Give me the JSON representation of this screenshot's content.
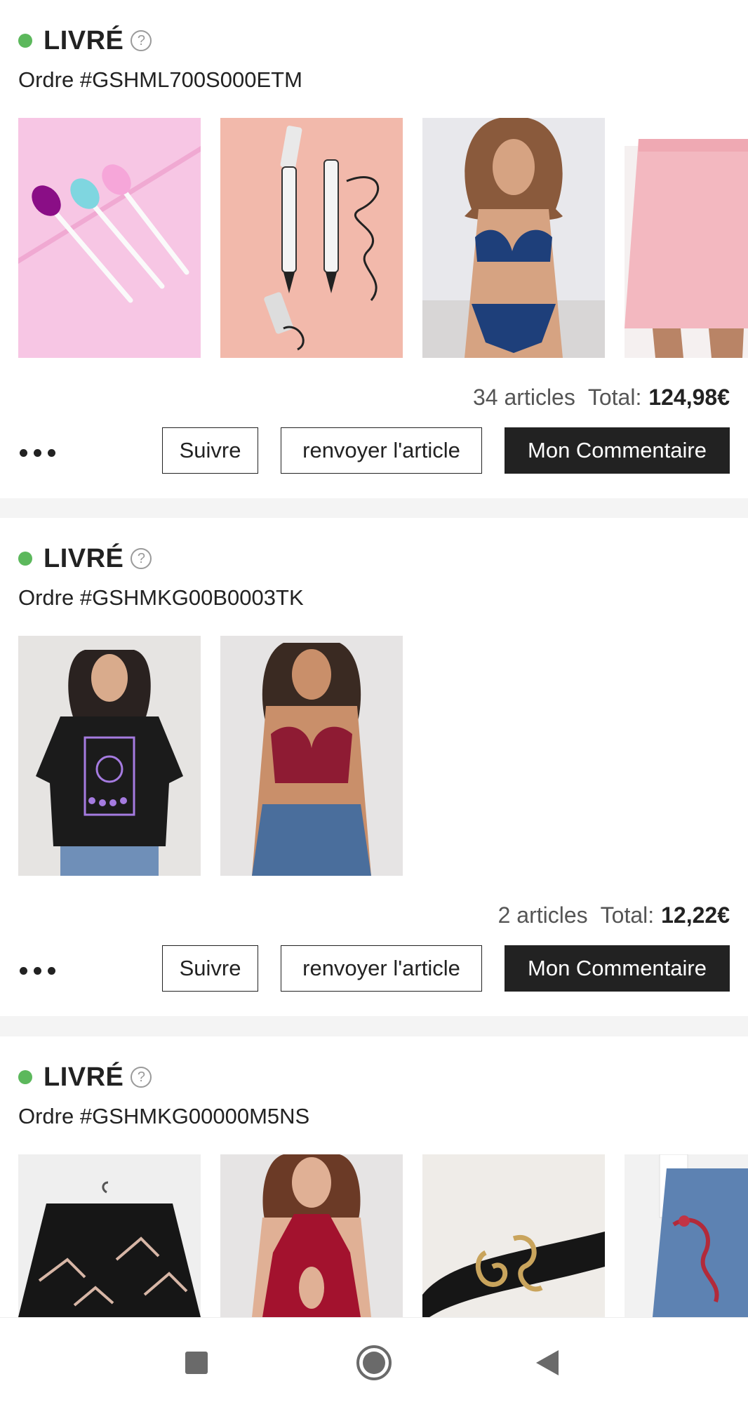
{
  "colors": {
    "accent": "#222222",
    "status_dot": "#5cb85c",
    "background": "#f4f4f4"
  },
  "orders": [
    {
      "status": "LIVRÉ",
      "order_number": "Ordre #GSHML700S000ETM",
      "item_count": "34 articles",
      "total_label": "Total:",
      "total_value": "124,98€",
      "thumbnails": [
        "silicone-lip-brushes",
        "eyeliner-pens",
        "blue-lace-lingerie",
        "pink-skirt"
      ]
    },
    {
      "status": "LIVRÉ",
      "order_number": "Ordre #GSHMKG00B0003TK",
      "item_count": "2 articles",
      "total_label": "Total:",
      "total_value": "12,22€",
      "thumbnails": [
        "black-graphic-tee",
        "red-lace-bralette"
      ]
    },
    {
      "status": "LIVRÉ",
      "order_number": "Ordre #GSHMKG00000M5NS",
      "thumbnails": [
        "black-crane-kimono",
        "red-lace-bodysuit",
        "snake-buckle-belt",
        "embroidered-jeans"
      ]
    }
  ],
  "actions": {
    "more_icon": "more-horizontal-icon",
    "follow_label": "Suivre",
    "return_label": "renvoyer l'article",
    "comment_label": "Mon Commentaire"
  },
  "navbar": {
    "icons": [
      "square-icon",
      "home-circle-icon",
      "back-triangle-icon"
    ]
  }
}
